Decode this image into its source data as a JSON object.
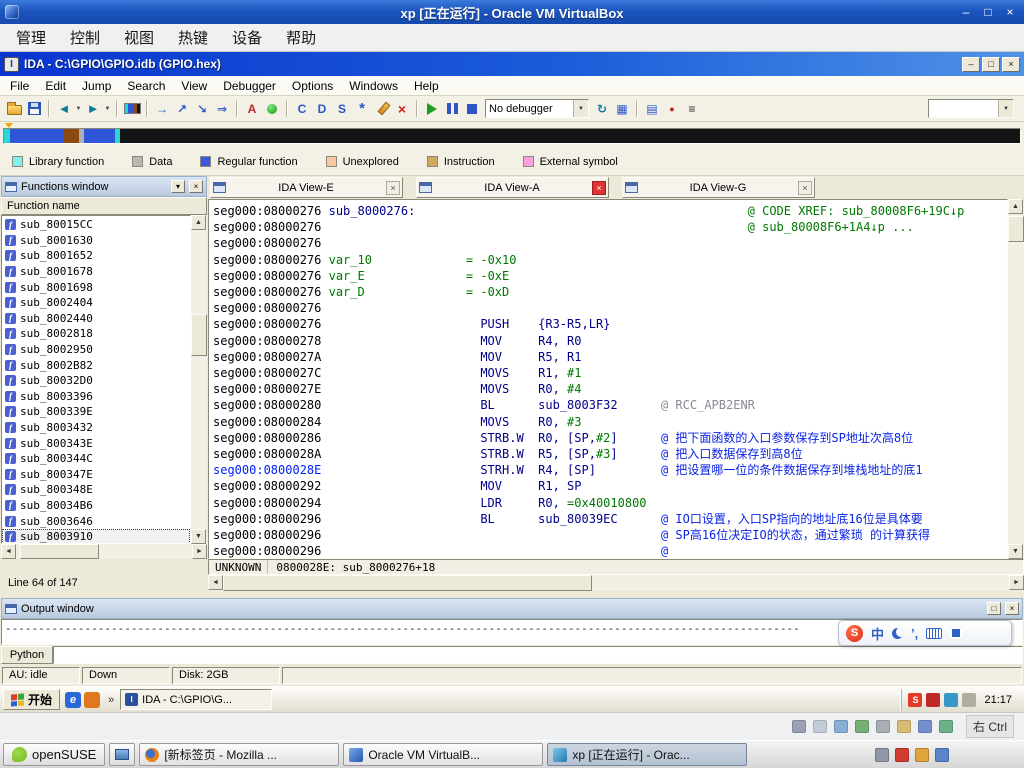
{
  "vbox": {
    "title": "xp [正在运行] - Oracle VM VirtualBox",
    "menus": [
      "管理",
      "控制",
      "视图",
      "热键",
      "设备",
      "帮助"
    ],
    "window_buttons": {
      "minimize": "–",
      "maximize": "□",
      "close": "×"
    },
    "host_key": "右 Ctrl",
    "status_icons": [
      {
        "name": "hdd-icon",
        "color": "#98a2b4"
      },
      {
        "name": "cd-icon",
        "color": "#c2ccd8"
      },
      {
        "name": "audio-icon",
        "color": "#88aed6"
      },
      {
        "name": "network-icon",
        "color": "#74b074"
      },
      {
        "name": "usb-icon",
        "color": "#a8aeb6"
      },
      {
        "name": "shared-folders-icon",
        "color": "#d8bc74"
      },
      {
        "name": "display-icon",
        "color": "#7490cc"
      },
      {
        "name": "mouse-integration-icon",
        "color": "#6cb08a"
      }
    ]
  },
  "ida": {
    "title": "IDA - C:\\GPIO\\GPIO.idb (GPIO.hex)",
    "menus": [
      "File",
      "Edit",
      "Jump",
      "Search",
      "View",
      "Debugger",
      "Options",
      "Windows",
      "Help"
    ],
    "toolbar": {
      "items": [
        {
          "name": "open-file-icon",
          "cssicon": "i-folder"
        },
        {
          "name": "save-file-icon",
          "cssicon": "i-disk"
        },
        {
          "type": "sep"
        },
        {
          "name": "navigate-back-icon",
          "glyph": "◄",
          "color": "#0d7f9e",
          "size": 13
        },
        {
          "name": "back-history-icon",
          "glyph": "▼",
          "color": "#444",
          "small": true,
          "size": 6
        },
        {
          "name": "navigate-forward-icon",
          "glyph": "►",
          "color": "#0d7f9e",
          "size": 13
        },
        {
          "name": "forward-history-icon",
          "glyph": "▼",
          "color": "#444",
          "small": true,
          "size": 6
        },
        {
          "type": "sep"
        },
        {
          "name": "navigator-icon",
          "cssicon": "i-band"
        },
        {
          "type": "sep"
        },
        {
          "name": "jump-address-icon",
          "glyph": "→",
          "color": "#2858c8"
        },
        {
          "name": "jump-name-icon",
          "glyph": "↗",
          "color": "#2858c8"
        },
        {
          "name": "jump-function-icon",
          "glyph": "↘",
          "color": "#2858c8"
        },
        {
          "name": "jump-segment-icon",
          "glyph": "⇒",
          "color": "#2858c8"
        },
        {
          "type": "sep"
        },
        {
          "name": "strings-window-icon",
          "glyph": "A",
          "color": "#c02828"
        },
        {
          "name": "colors-icon",
          "cssicon": "i-dot"
        },
        {
          "type": "sep"
        },
        {
          "name": "make-code-icon",
          "glyph": "C",
          "color": "#2858c8"
        },
        {
          "name": "make-data-icon",
          "glyph": "D",
          "color": "#2858c8"
        },
        {
          "name": "make-struct-icon",
          "glyph": "S",
          "color": "#2858c8"
        },
        {
          "name": "make-enum-icon",
          "glyph": "*",
          "color": "#2858c8",
          "size": 15
        },
        {
          "name": "edit-comment-icon",
          "cssicon": "i-pencil"
        },
        {
          "name": "undefine-icon",
          "glyph": "×",
          "color": "#d02020",
          "size": 14
        },
        {
          "type": "sep"
        },
        {
          "name": "start-process-icon",
          "cssicon": "i-play"
        },
        {
          "name": "pause-process-icon",
          "cssicon": "i-pause"
        },
        {
          "name": "stop-process-icon",
          "cssicon": "i-stop"
        },
        {
          "name": "debugger-select",
          "type": "combo",
          "text": "No debugger",
          "wide": true
        },
        {
          "name": "attach-process-icon",
          "glyph": "↻",
          "color": "#0d7f9e"
        },
        {
          "name": "debugger-windows-icon",
          "glyph": "▦",
          "color": "#2858c8"
        },
        {
          "type": "sep"
        },
        {
          "name": "calculator-icon",
          "glyph": "▤",
          "color": "#2858c8"
        },
        {
          "name": "breakpoints-icon",
          "glyph": "●",
          "color": "#c02020",
          "size": 9
        },
        {
          "name": "script-icon",
          "glyph": "≡",
          "color": "#303030"
        },
        {
          "name": "search-box",
          "type": "combo",
          "text": "",
          "push": true
        }
      ]
    },
    "navband": {
      "segments": [
        {
          "name": "band-library",
          "color": "#2ad8d8",
          "pct": 0.6
        },
        {
          "name": "band-regular-1",
          "color": "#2f55d8",
          "pct": 5.2
        },
        {
          "name": "band-instruction",
          "color": "#8a4a10",
          "pct": 1.6
        },
        {
          "name": "band-data",
          "color": "#b0b0b0",
          "pct": 0.5
        },
        {
          "name": "band-regular-2",
          "color": "#2f55d8",
          "pct": 3.0
        },
        {
          "name": "band-library-2",
          "color": "#2ad8d8",
          "pct": 0.5
        },
        {
          "name": "band-unexplored",
          "color": "#141414",
          "pct": 88.6
        }
      ]
    },
    "legend": [
      {
        "label": "Library function",
        "color": "#80f0f0"
      },
      {
        "label": "Data",
        "color": "#b8b8b8"
      },
      {
        "label": "Regular function",
        "color": "#3c58dc"
      },
      {
        "label": "Unexplored",
        "color": "#f8c8a0"
      },
      {
        "label": "Instruction",
        "color": "#d0a860"
      },
      {
        "label": "External symbol",
        "color": "#f8a0e0"
      }
    ],
    "functions": {
      "title": "Functions window",
      "column": "Function name",
      "items": [
        "sub_80015CC",
        "sub_8001630",
        "sub_8001652",
        "sub_8001678",
        "sub_8001698",
        "sub_8002404",
        "sub_8002440",
        "sub_8002818",
        "sub_8002950",
        "sub_8002B82",
        "sub_80032D0",
        "sub_8003396",
        "sub_800339E",
        "sub_8003432",
        "sub_800343E",
        "sub_800344C",
        "sub_800347E",
        "sub_800348E",
        "sub_80034B6",
        "sub_8003646",
        "sub_8003910"
      ],
      "selected": "sub_8003910",
      "line_status": "Line 64 of 147"
    },
    "tabs": [
      {
        "label": "IDA View-E",
        "active": false
      },
      {
        "label": "IDA View-A",
        "active": true
      },
      {
        "label": "IDA View-G",
        "active": false
      }
    ],
    "disasm": {
      "lines": [
        {
          "addr": "seg000:08000276",
          "parts": [
            [
              "pl",
              " "
            ],
            [
              "lbl",
              "sub_8000276:"
            ],
            [
              "pl",
              "                                              "
            ],
            [
              "g",
              "@ CODE XREF: sub_80008F6+19C↓p"
            ]
          ]
        },
        {
          "addr": "seg000:08000276",
          "parts": [
            [
              "pl",
              "                                                           "
            ],
            [
              "g",
              "@ sub_80008F6+1A4↓p ..."
            ]
          ]
        },
        {
          "addr": "seg000:08000276",
          "parts": []
        },
        {
          "addr": "seg000:08000276",
          "parts": [
            [
              "pl",
              " "
            ],
            [
              "g",
              "var_10"
            ],
            [
              "pl",
              "             "
            ],
            [
              "g",
              "= -0x10"
            ]
          ]
        },
        {
          "addr": "seg000:08000276",
          "parts": [
            [
              "pl",
              " "
            ],
            [
              "g",
              "var_E"
            ],
            [
              "pl",
              "              "
            ],
            [
              "g",
              "= -0xE"
            ]
          ]
        },
        {
          "addr": "seg000:08000276",
          "parts": [
            [
              "pl",
              " "
            ],
            [
              "g",
              "var_D"
            ],
            [
              "pl",
              "              "
            ],
            [
              "g",
              "= -0xD"
            ]
          ]
        },
        {
          "addr": "seg000:08000276",
          "parts": []
        },
        {
          "addr": "seg000:08000276",
          "parts": [
            [
              "pl",
              "                      "
            ],
            [
              "mn",
              "PUSH"
            ],
            [
              "pl",
              "    "
            ],
            [
              "mn",
              "{R3-R5,LR}"
            ]
          ]
        },
        {
          "addr": "seg000:08000278",
          "parts": [
            [
              "pl",
              "                      "
            ],
            [
              "mn",
              "MOV"
            ],
            [
              "pl",
              "     "
            ],
            [
              "mn",
              "R4, R0"
            ]
          ]
        },
        {
          "addr": "seg000:0800027A",
          "parts": [
            [
              "pl",
              "                      "
            ],
            [
              "mn",
              "MOV"
            ],
            [
              "pl",
              "     "
            ],
            [
              "mn",
              "R5, R1"
            ]
          ]
        },
        {
          "addr": "seg000:0800027C",
          "parts": [
            [
              "pl",
              "                      "
            ],
            [
              "mn",
              "MOVS"
            ],
            [
              "pl",
              "    "
            ],
            [
              "mn",
              "R1, "
            ],
            [
              "g",
              "#1"
            ]
          ]
        },
        {
          "addr": "seg000:0800027E",
          "parts": [
            [
              "pl",
              "                      "
            ],
            [
              "mn",
              "MOVS"
            ],
            [
              "pl",
              "    "
            ],
            [
              "mn",
              "R0, "
            ],
            [
              "g",
              "#4"
            ]
          ]
        },
        {
          "addr": "seg000:08000280",
          "parts": [
            [
              "pl",
              "                      "
            ],
            [
              "mn",
              "BL"
            ],
            [
              "pl",
              "      "
            ],
            [
              "mn",
              "sub_8003F32"
            ],
            [
              "pl",
              "      "
            ],
            [
              "cg",
              "@ RCC_APB2ENR"
            ]
          ]
        },
        {
          "addr": "seg000:08000284",
          "parts": [
            [
              "pl",
              "                      "
            ],
            [
              "mn",
              "MOVS"
            ],
            [
              "pl",
              "    "
            ],
            [
              "mn",
              "R0, "
            ],
            [
              "g",
              "#3"
            ]
          ]
        },
        {
          "addr": "seg000:08000286",
          "parts": [
            [
              "pl",
              "                      "
            ],
            [
              "mn",
              "STRB.W"
            ],
            [
              "pl",
              "  "
            ],
            [
              "mn",
              "R0, [SP,"
            ],
            [
              "g",
              "#2"
            ],
            [
              "mn",
              "]"
            ],
            [
              "pl",
              "      "
            ],
            [
              "cb",
              "@ 把下面函数的入口参数保存到SP地址次高8位"
            ]
          ]
        },
        {
          "addr": "seg000:0800028A",
          "parts": [
            [
              "pl",
              "                      "
            ],
            [
              "mn",
              "STRB.W"
            ],
            [
              "pl",
              "  "
            ],
            [
              "mn",
              "R5, [SP,"
            ],
            [
              "g",
              "#3"
            ],
            [
              "mn",
              "]"
            ],
            [
              "pl",
              "      "
            ],
            [
              "cb",
              "@ 把入口数据保存到高8位"
            ]
          ]
        },
        {
          "addr": "seg000:0800028E",
          "cur": true,
          "parts": [
            [
              "pl",
              "                      "
            ],
            [
              "mn",
              "STRH.W"
            ],
            [
              "pl",
              "  "
            ],
            [
              "mn",
              "R4, [SP]"
            ],
            [
              "pl",
              "         "
            ],
            [
              "cb",
              "@ 把设置哪一位的条件数据保存到堆栈地址的底1"
            ]
          ]
        },
        {
          "addr": "seg000:08000292",
          "parts": [
            [
              "pl",
              "                      "
            ],
            [
              "mn",
              "MOV"
            ],
            [
              "pl",
              "     "
            ],
            [
              "mn",
              "R1, SP"
            ]
          ]
        },
        {
          "addr": "seg000:08000294",
          "parts": [
            [
              "pl",
              "                      "
            ],
            [
              "mn",
              "LDR"
            ],
            [
              "pl",
              "     "
            ],
            [
              "mn",
              "R0, "
            ],
            [
              "g",
              "=0x40010800"
            ]
          ]
        },
        {
          "addr": "seg000:08000296",
          "parts": [
            [
              "pl",
              "                      "
            ],
            [
              "mn",
              "BL"
            ],
            [
              "pl",
              "      "
            ],
            [
              "mn",
              "sub_80039EC"
            ],
            [
              "pl",
              "      "
            ],
            [
              "cb",
              "@ IO口设置，入口SP指向的地址底16位是具体要"
            ]
          ]
        },
        {
          "addr": "seg000:08000296",
          "parts": [
            [
              "pl",
              "                                               "
            ],
            [
              "cb",
              "@ SP高16位决定IO的状态，通过繁琐 的计算获得"
            ]
          ]
        },
        {
          "addr": "seg000:08000296",
          "parts": [
            [
              "pl",
              "                                               "
            ],
            [
              "cb",
              "@"
            ]
          ]
        }
      ]
    },
    "position_bar": {
      "state": "UNKNOWN",
      "location": "0800028E: sub_8000276+18"
    },
    "output": {
      "title": "Output window",
      "log_line": "------------------------------------------------------------------------------------------------------------------------",
      "cli_label": "Python",
      "cli_value": ""
    },
    "statusbar": [
      "AU: idle",
      "Down",
      "Disk: 2GB"
    ]
  },
  "xp_taskbar": {
    "start_label": "开始",
    "quick_launch": [
      {
        "name": "ie-quicklaunch-icon",
        "color": "#2868d8",
        "glyph": "e"
      },
      {
        "name": "media-player-quicklaunch-icon",
        "color": "#e07820"
      }
    ],
    "overflow_chevron": "»",
    "task_label": "IDA - C:\\GPIO\\G...",
    "tray_icons": [
      {
        "name": "sogou-input-tray-icon",
        "color": "#e23c28",
        "glyph": "S"
      },
      {
        "name": "ime-mode-tray-icon",
        "color": "#c02828"
      },
      {
        "name": "safety-tray-icon",
        "color": "#3898c8"
      },
      {
        "name": "volume-tray-icon",
        "color": "#b0aca0"
      }
    ],
    "clock": "21:17"
  },
  "sogou_bar": {
    "items": [
      {
        "name": "sogou-logo-icon",
        "type": "logo",
        "glyph": "S"
      },
      {
        "name": "chinese-english-toggle",
        "type": "text",
        "glyph": "中"
      },
      {
        "name": "fullwidth-halfwidth-toggle",
        "type": "moon"
      },
      {
        "name": "punctuation-toggle",
        "type": "text",
        "glyph": "’,"
      },
      {
        "name": "soft-keyboard-icon",
        "type": "kbd"
      },
      {
        "name": "toolbox-icon",
        "type": "tool"
      }
    ]
  },
  "linux_taskbar": {
    "launcher_label": "openSUSE",
    "tasks": [
      {
        "label": "[新标签页 - Mozilla ...",
        "icon": "firefox-icon",
        "active": false
      },
      {
        "label": "Oracle VM VirtualB...",
        "icon": "virtualbox-icon",
        "active": false
      },
      {
        "label": "xp [正在运行] - Orac...",
        "icon": "virtualbox-vm-icon",
        "active": true
      }
    ],
    "tray_icons": [
      {
        "name": "keyboard-layout-icon",
        "color": "#9098a8"
      },
      {
        "name": "update-notifier-icon",
        "color": "#d23c30"
      },
      {
        "name": "klipper-icon",
        "color": "#e0a43a"
      },
      {
        "name": "network-manager-icon",
        "color": "#5a84c8"
      }
    ]
  }
}
